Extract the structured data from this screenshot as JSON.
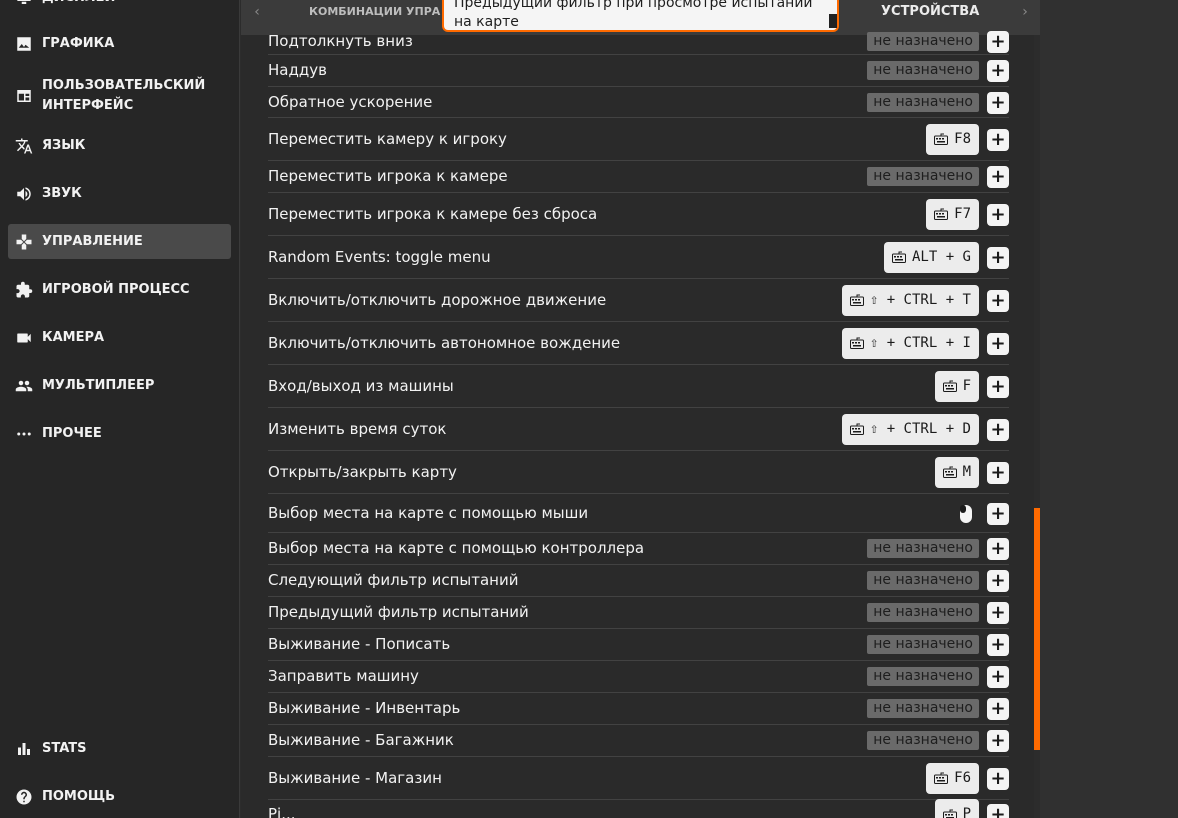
{
  "sidebar": {
    "items": [
      {
        "label": "ДИСПЛЕЙ",
        "icon": "display-icon"
      },
      {
        "label": "ГРАФИКА",
        "icon": "image-icon"
      },
      {
        "label": "ПОЛЬЗОВАТЕЛЬСКИЙ\nИНТЕРФЕЙС",
        "icon": "ui-window-icon"
      },
      {
        "label": "ЯЗЫК",
        "icon": "translate-icon"
      },
      {
        "label": "ЗВУК",
        "icon": "speaker-icon"
      },
      {
        "label": "УПРАВЛЕНИЕ",
        "icon": "gamepad-icon",
        "active": true
      },
      {
        "label": "ИГРОВОЙ ПРОЦЕСС",
        "icon": "puzzle-icon"
      },
      {
        "label": "КАМЕРА",
        "icon": "camera-icon"
      },
      {
        "label": "МУЛЬТИПЛЕЕР",
        "icon": "people-icon"
      },
      {
        "label": "ПРОЧЕЕ",
        "icon": "more-dots-icon"
      }
    ],
    "bottom_items": [
      {
        "label": "STATS",
        "icon": "bar-chart-icon"
      },
      {
        "label": "ПОМОЩЬ",
        "icon": "help-icon"
      }
    ]
  },
  "tabs": {
    "left": "КОМБИНАЦИИ УПРА",
    "right": "УСТРОЙСТВА",
    "prev_arrow": "‹",
    "next_arrow": "›"
  },
  "tooltip": {
    "text": "Предыдущий фильтр при просмотре испытаний на карте"
  },
  "unassigned_text": "не назначено",
  "add_symbol": "+",
  "bindings": [
    {
      "label": "Подтолкнуть вниз",
      "type": "none"
    },
    {
      "label": "Наддув",
      "type": "none"
    },
    {
      "label": "Обратное ускорение",
      "type": "none"
    },
    {
      "label": "Переместить камеру к игроку",
      "type": "key",
      "key": "F8"
    },
    {
      "label": "Переместить игрока к камере",
      "type": "none"
    },
    {
      "label": "Переместить игрока к камере без сброса",
      "type": "key",
      "key": "F7"
    },
    {
      "label": "Random Events: toggle menu",
      "type": "key",
      "key": "ALT + G"
    },
    {
      "label": "Включить/отключить дорожное движение",
      "type": "key",
      "key": "⇧ + CTRL + T"
    },
    {
      "label": "Включить/отключить автономное вождение",
      "type": "key",
      "key": "⇧ + CTRL + I"
    },
    {
      "label": "Вход/выход из машины",
      "type": "key",
      "key": "F"
    },
    {
      "label": "Изменить время суток",
      "type": "key",
      "key": "⇧ + CTRL + D"
    },
    {
      "label": "Открыть/закрыть карту",
      "type": "key",
      "key": "M"
    },
    {
      "label": "Выбор места на карте с помощью мыши",
      "type": "mouse"
    },
    {
      "label": "Выбор места на карте с помощью контроллера",
      "type": "none"
    },
    {
      "label": "Следующий фильтр испытаний",
      "type": "none"
    },
    {
      "label": "Предыдущий фильтр испытаний",
      "type": "none"
    },
    {
      "label": "Выживание - Пописать",
      "type": "none"
    },
    {
      "label": "Заправить машину",
      "type": "none"
    },
    {
      "label": "Выживание - Инвентарь",
      "type": "none"
    },
    {
      "label": "Выживание - Багажник",
      "type": "none"
    },
    {
      "label": "Выживание - Магазин",
      "type": "key",
      "key": "F6"
    },
    {
      "label": "Рі...",
      "type": "key",
      "key": "P"
    }
  ],
  "colors": {
    "accent": "#ff6a00",
    "sidebar_bg": "#262626",
    "panel_bg": "#2a2a2a",
    "unassigned_bg": "#6a6a6a",
    "key_bg": "#ececec"
  }
}
